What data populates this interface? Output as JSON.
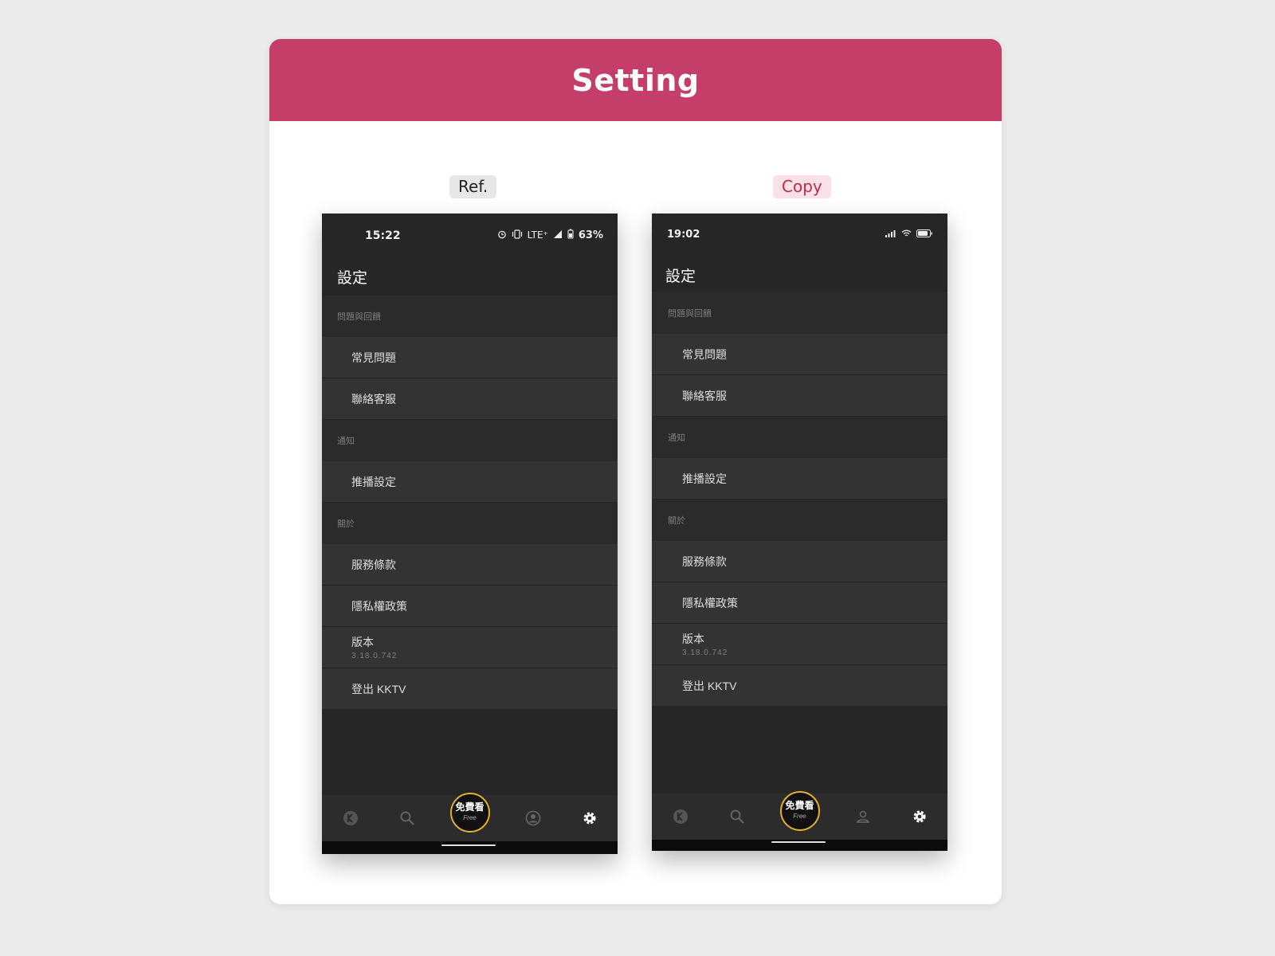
{
  "header": {
    "title": "Setting"
  },
  "tags": {
    "ref": "Ref.",
    "copy": "Copy"
  },
  "ref_phone": {
    "status": {
      "time": "15:22",
      "network": "LTE⁺",
      "battery": "63%"
    },
    "appbar_title": "設定",
    "sections": {
      "feedback": "問題與回饋",
      "notification": "通知",
      "about": "關於"
    },
    "items": {
      "faq": "常見問題",
      "contact": "聯絡客服",
      "push": "推播設定",
      "terms": "服務條款",
      "privacy": "隱私權政策",
      "version_label": "版本",
      "version_value": "3.18.0.742",
      "logout": "登出 KKTV"
    },
    "nav": {
      "free_zh": "免費看",
      "free_en": "Free"
    }
  },
  "copy_phone": {
    "status": {
      "time": "19:02"
    },
    "appbar_title": "設定",
    "sections": {
      "feedback": "問題與回饋",
      "notification": "通知",
      "about": "關於"
    },
    "items": {
      "faq": "常見問題",
      "contact": "聯絡客服",
      "push": "推播設定",
      "terms": "服務條款",
      "privacy": "隱私權政策",
      "version_label": "版本",
      "version_value": "3.18.0.742",
      "logout": "登出 KKTV"
    },
    "nav": {
      "free_zh": "免費看",
      "free_en": "Free"
    }
  },
  "colors": {
    "header_bg": "#c43e69",
    "copy_tag_text": "#c0284f",
    "badge_ring": "#e3b22a"
  },
  "icons": [
    "alarm-icon",
    "vibrate-icon",
    "signal-icon",
    "battery-icon",
    "wifi-icon",
    "kktv-logo-icon",
    "search-icon",
    "profile-icon",
    "settings-gear-icon"
  ]
}
